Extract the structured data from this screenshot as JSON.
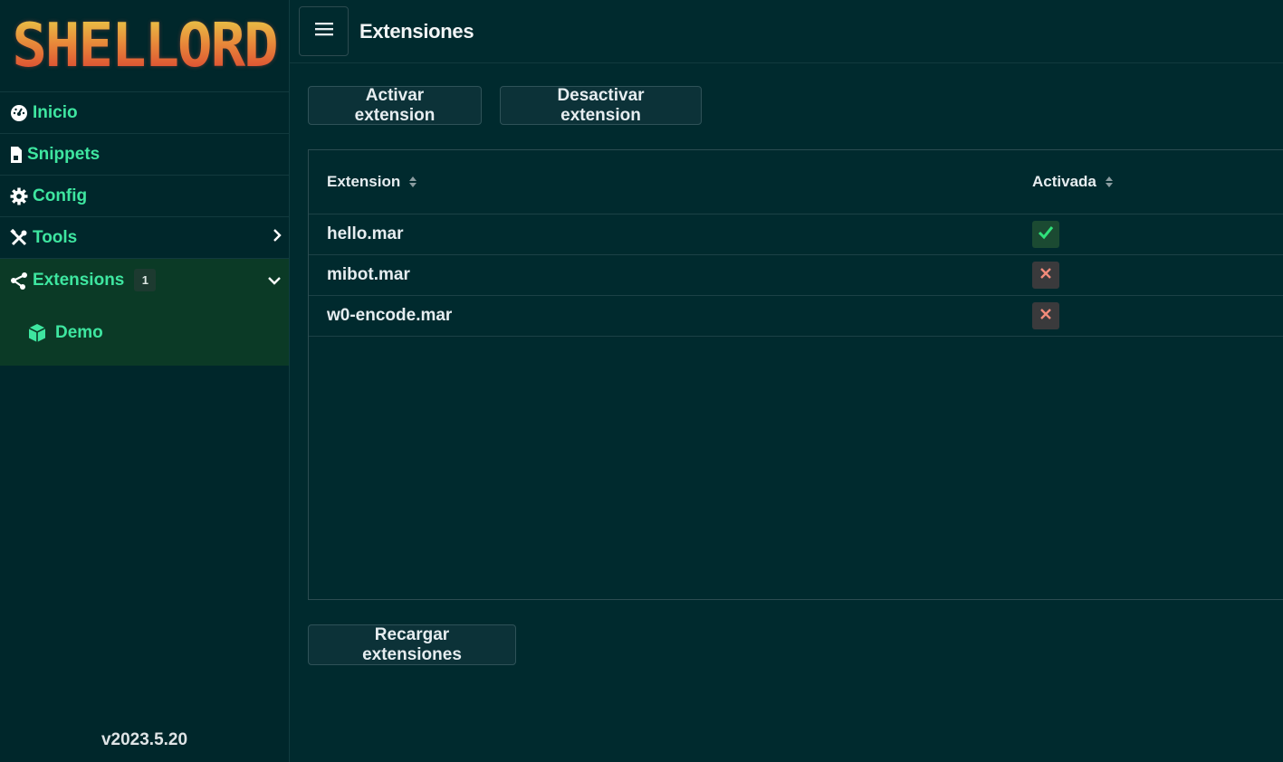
{
  "app": {
    "logo_text": "SHELLORD",
    "version": "v2023.5.20"
  },
  "sidebar": {
    "items": [
      {
        "label": "Inicio",
        "icon": "dashboard-icon"
      },
      {
        "label": "Snippets",
        "icon": "file-code-icon"
      },
      {
        "label": "Config",
        "icon": "gear-icon"
      },
      {
        "label": "Tools",
        "icon": "tools-icon"
      },
      {
        "label": "Extensions",
        "icon": "share-nodes-icon",
        "badge": "1"
      }
    ],
    "sub_items": [
      {
        "label": "Demo",
        "icon": "cube-icon"
      }
    ]
  },
  "header": {
    "title": "Extensiones"
  },
  "toolbar": {
    "activate_label": "Activar extension",
    "deactivate_label": "Desactivar extension",
    "reload_label": "Recargar extensiones"
  },
  "table": {
    "columns": [
      "Extension",
      "Activada"
    ],
    "rows": [
      {
        "name": "hello.mar",
        "active": true
      },
      {
        "name": "mibot.mar",
        "active": false
      },
      {
        "name": "w0-encode.mar",
        "active": false
      }
    ]
  },
  "colors": {
    "accent": "#3ee6a0",
    "background": "#002a2e",
    "active_bg": "#1b4a32",
    "inactive_icon": "#f28b7a"
  }
}
